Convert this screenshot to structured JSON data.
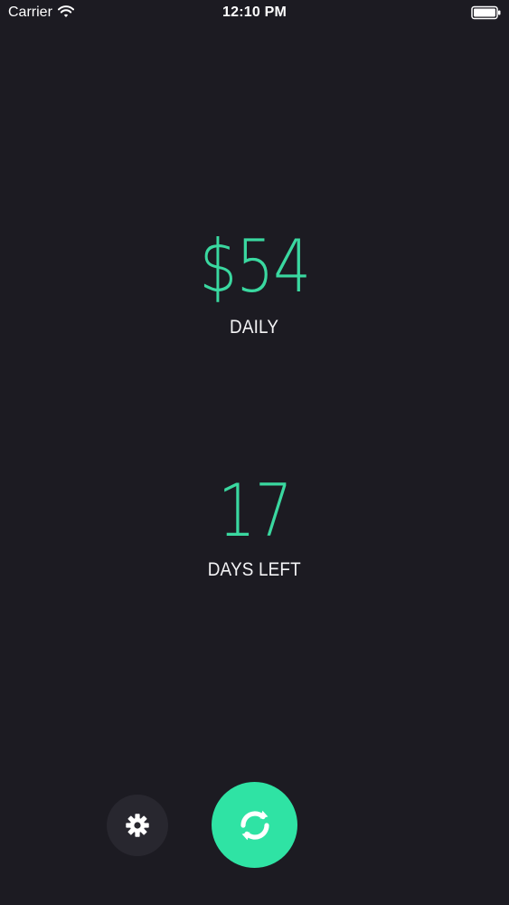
{
  "status_bar": {
    "carrier": "Carrier",
    "time": "12:10 PM"
  },
  "daily": {
    "value": "$54",
    "label": "DAILY"
  },
  "days_left": {
    "value": "17",
    "label": "DAYS LEFT"
  },
  "icons": {
    "settings": "gear-icon",
    "refresh": "refresh-icon",
    "wifi": "wifi-icon",
    "battery": "battery-icon"
  },
  "colors": {
    "background": "#1c1b22",
    "accent": "#3ad8a0",
    "button_accent": "#2fe3a4",
    "secondary_button": "#28272f"
  }
}
